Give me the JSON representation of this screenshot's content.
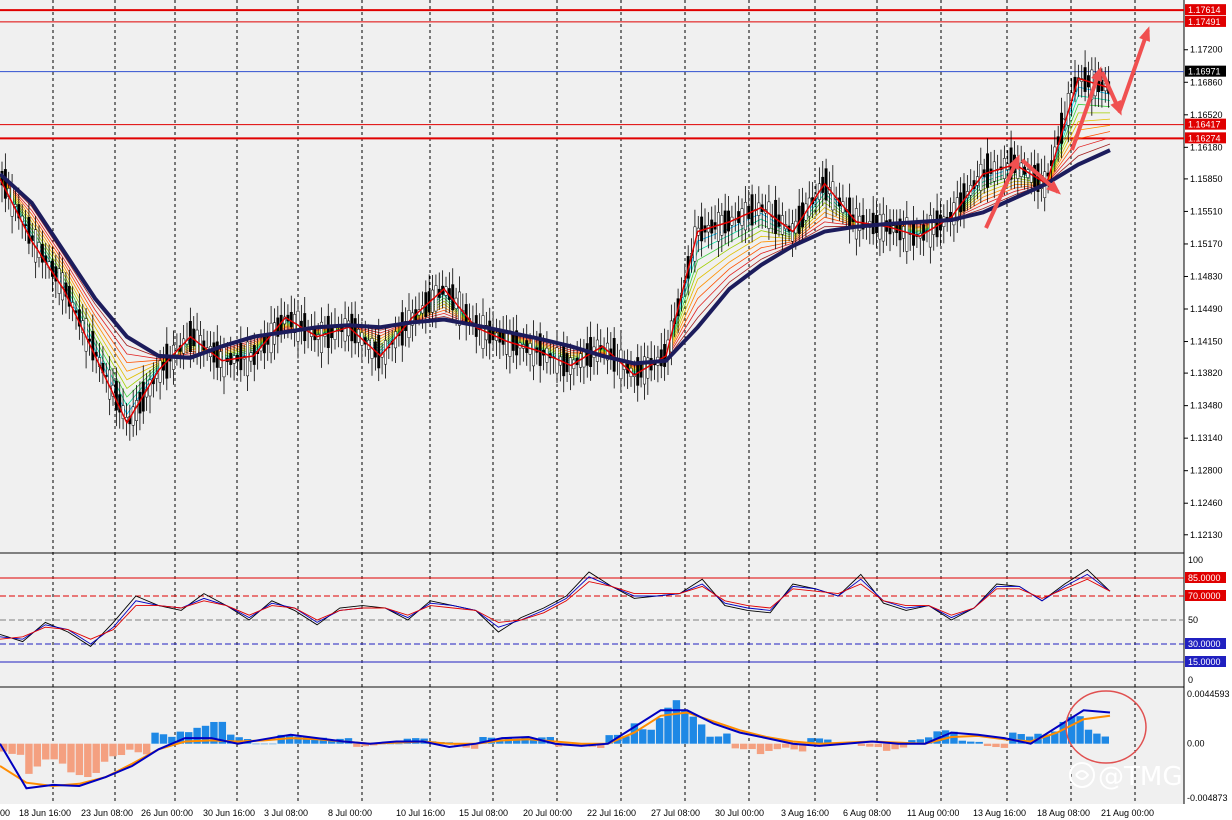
{
  "chart_data": [
    {
      "type": "line",
      "title": "",
      "price_axis_labels": [
        "1.17200",
        "1.16860",
        "1.16520",
        "1.16180",
        "1.15850",
        "1.15510",
        "1.15170",
        "1.14830",
        "1.14490",
        "1.14150",
        "1.13820",
        "1.13480",
        "1.13140",
        "1.12800",
        "1.12460",
        "1.12130"
      ],
      "highlighted_levels": [
        {
          "value": 1.17614,
          "label": "1.17614",
          "color": "#e00000"
        },
        {
          "value": 1.17491,
          "label": "1.17491",
          "color": "#e00000"
        },
        {
          "value": 1.16971,
          "label": "1.16971",
          "color": "#000000"
        },
        {
          "value": 1.16417,
          "label": "1.16417",
          "color": "#e00000"
        },
        {
          "value": 1.16274,
          "label": "1.16274",
          "color": "#e00000"
        }
      ],
      "ylim": [
        1.1195,
        1.1772
      ],
      "x_labels": [
        "00",
        "18 Jun 16:00",
        "23 Jun 08:00",
        "26 Jun 00:00",
        "30 Jun 16:00",
        "3 Jul 08:00",
        "8 Jul 00:00",
        "10 Jul 16:00",
        "15 Jul 08:00",
        "20 Jul 00:00",
        "22 Jul 16:00",
        "27 Jul 08:00",
        "30 Jul 00:00",
        "3 Aug 16:00",
        "6 Aug 08:00",
        "11 Aug 00:00",
        "13 Aug 16:00",
        "18 Aug 08:00",
        "21 Aug 00:00"
      ],
      "series": [
        {
          "values": [
            1.1585,
            1.152,
            1.147,
            1.14,
            1.133,
            1.1385,
            1.142,
            1.1395,
            1.14,
            1.144,
            1.142,
            1.143,
            1.14,
            1.144,
            1.147,
            1.143,
            1.1415,
            1.1405,
            1.139,
            1.141,
            1.138,
            1.14,
            1.153,
            1.154,
            1.1555,
            1.153,
            1.158,
            1.154,
            1.1535,
            1.1525,
            1.1545,
            1.159,
            1.16,
            1.158,
            1.169,
            1.168
          ]
        },
        {
          "values": [
            1.159,
            1.156,
            1.151,
            1.146,
            1.142,
            1.14,
            1.1398,
            1.141,
            1.142,
            1.1425,
            1.143,
            1.1432,
            1.143,
            1.1435,
            1.1438,
            1.1432,
            1.1425,
            1.1418,
            1.141,
            1.14,
            1.1392,
            1.1395,
            1.143,
            1.147,
            1.1495,
            1.1515,
            1.153,
            1.1535,
            1.1538,
            1.154,
            1.1542,
            1.155,
            1.1565,
            1.158,
            1.16,
            1.1615
          ]
        }
      ]
    },
    {
      "type": "line",
      "axis_labels": [
        "100",
        "85.0000",
        "70.0000",
        "50",
        "30.0000",
        "15.0000",
        "0"
      ],
      "levels": [
        85,
        70,
        50,
        30,
        15
      ],
      "ylim": [
        0,
        100
      ],
      "series": [
        {
          "values": [
            38,
            32,
            48,
            40,
            28,
            48,
            70,
            62,
            58,
            72,
            62,
            50,
            66,
            58,
            46,
            60,
            62,
            60,
            50,
            66,
            62,
            58,
            40,
            52,
            60,
            70,
            90,
            78,
            68,
            70,
            72,
            84,
            62,
            58,
            56,
            80,
            76,
            70,
            88,
            64,
            58,
            62,
            50,
            60,
            80,
            78,
            66,
            80,
            92,
            74
          ]
        },
        {
          "values": [
            36,
            34,
            46,
            42,
            30,
            44,
            66,
            62,
            60,
            68,
            62,
            52,
            64,
            60,
            48,
            58,
            60,
            60,
            52,
            64,
            62,
            58,
            44,
            50,
            58,
            68,
            86,
            78,
            70,
            70,
            72,
            80,
            64,
            60,
            58,
            78,
            76,
            70,
            84,
            66,
            60,
            62,
            52,
            60,
            78,
            78,
            66,
            78,
            88,
            74
          ]
        },
        {
          "values": [
            34,
            36,
            44,
            42,
            34,
            42,
            62,
            62,
            60,
            66,
            62,
            54,
            62,
            60,
            50,
            58,
            60,
            60,
            54,
            62,
            60,
            58,
            48,
            50,
            56,
            66,
            82,
            78,
            72,
            72,
            72,
            78,
            66,
            62,
            60,
            76,
            74,
            72,
            80,
            66,
            62,
            62,
            54,
            60,
            76,
            76,
            68,
            76,
            84,
            74
          ]
        }
      ]
    },
    {
      "type": "bar",
      "axis_labels": [
        "0.0044593",
        "0.00",
        "-0.004873"
      ],
      "ylim": [
        -0.004873,
        0.0044593
      ],
      "series": [
        {
          "values": [
            -0.001,
            -0.003,
            -0.0035,
            -0.003,
            -0.0025,
            -0.001,
            0.001,
            0.0025,
            0.002,
            0.001,
            0.0,
            0.0008,
            0.0012,
            0.0005,
            -0.0003,
            0.0,
            0.0005,
            0.0003,
            -0.0005,
            0.0006,
            0.001,
            0.0006,
            -0.0003,
            -0.0005,
            0.0008,
            0.003,
            0.004,
            0.003,
            0.0015,
            -0.0005,
            -0.0012,
            -0.0008,
            0.0005,
            0.0002,
            -0.0003,
            -0.0007,
            0.0008,
            0.0012,
            0.0004,
            -0.0004,
            0.001,
            0.002,
            0.0025,
            0.0015
          ]
        },
        {
          "values": [
            0.0,
            -0.004,
            -0.0037,
            -0.0038,
            -0.003,
            -0.002,
            -0.0005,
            0.0005,
            0.0005,
            0.0,
            0.0004,
            0.0008,
            0.0005,
            0.0002,
            0.0,
            0.0002,
            0.0002,
            -0.0003,
            0.0,
            0.0005,
            0.0006,
            0.0,
            -0.0002,
            0.0,
            0.0015,
            0.003,
            0.003,
            0.0018,
            0.001,
            0.0005,
            0.0,
            -0.0002,
            0.0,
            0.0002,
            0.0,
            0.0,
            0.001,
            0.0008,
            0.0005,
            0.0,
            0.0015,
            0.003,
            0.0028
          ]
        },
        {
          "values": [
            -0.002,
            -0.0035,
            -0.0038,
            -0.0036,
            -0.003,
            -0.0018,
            -0.0005,
            0.0002,
            0.0003,
            0.0002,
            0.0003,
            0.0005,
            0.0004,
            0.0002,
            0.0,
            0.0001,
            0.0002,
            0.0,
            0.0,
            0.0003,
            0.0004,
            0.0002,
            0.0,
            0.0,
            0.001,
            0.0025,
            0.0028,
            0.002,
            0.0012,
            0.0006,
            0.0002,
            0.0,
            0.0001,
            0.0002,
            0.0001,
            0.0,
            0.0006,
            0.0007,
            0.0004,
            0.0002,
            0.001,
            0.0022,
            0.0025
          ]
        }
      ]
    }
  ],
  "watermark": {
    "text": "@TMGM",
    "icon": "tmgm-logo-icon"
  },
  "colors": {
    "ema_slow": "#1c1c5c",
    "zigzag": "#e00000",
    "hist_pos": "#1e88e5",
    "hist_neg": "#f4a080",
    "signal": "#ff8c00",
    "macd": "#0000c0"
  }
}
